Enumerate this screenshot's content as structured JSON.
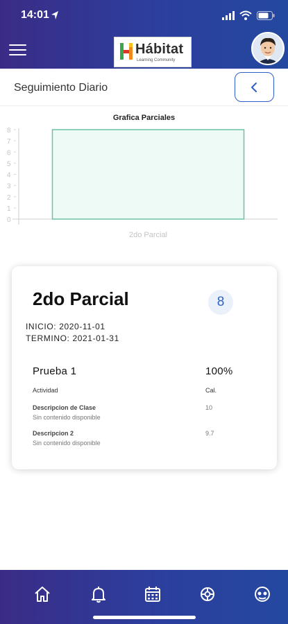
{
  "status_bar": {
    "time": "14:01"
  },
  "header": {
    "logo_word": "Hábitat",
    "logo_sub": "Learning Community"
  },
  "subheader": {
    "title": "Seguimiento Diario"
  },
  "chart_data": {
    "type": "bar",
    "title": "Grafica Parciales",
    "categories": [
      "2do Parcial"
    ],
    "values": [
      8
    ],
    "ylim": [
      0,
      8
    ],
    "yticks": [
      "0",
      "1",
      "2",
      "3",
      "4",
      "5",
      "6",
      "7",
      "8"
    ],
    "grid": false,
    "bar_fill": "#eefaf6",
    "bar_stroke": "#6cc2a6"
  },
  "card": {
    "title": "2do Parcial",
    "grade": "8",
    "inicio_label": "INICIO:",
    "inicio_value": "2020-11-01",
    "termino_label": "TERMINO:",
    "termino_value": "2021-01-31",
    "test_name": "Prueba 1",
    "test_percent": "100%",
    "col_activity": "Actividad",
    "col_cal": "Cal.",
    "items": [
      {
        "title": "Descripcion de Clase",
        "desc": "Sin contenido disponible",
        "value": "10"
      },
      {
        "title": "Descripcion 2",
        "desc": "Sin contenido disponible",
        "value": "9.7"
      }
    ]
  },
  "colors": {
    "brand_gradient_start": "#3a2c86",
    "brand_gradient_end": "#24489f",
    "accent": "#2f5fc6"
  },
  "tabs": [
    {
      "icon": "home-icon"
    },
    {
      "icon": "bell-icon"
    },
    {
      "icon": "calendar-icon"
    },
    {
      "icon": "settings-icon"
    },
    {
      "icon": "support-icon"
    }
  ]
}
